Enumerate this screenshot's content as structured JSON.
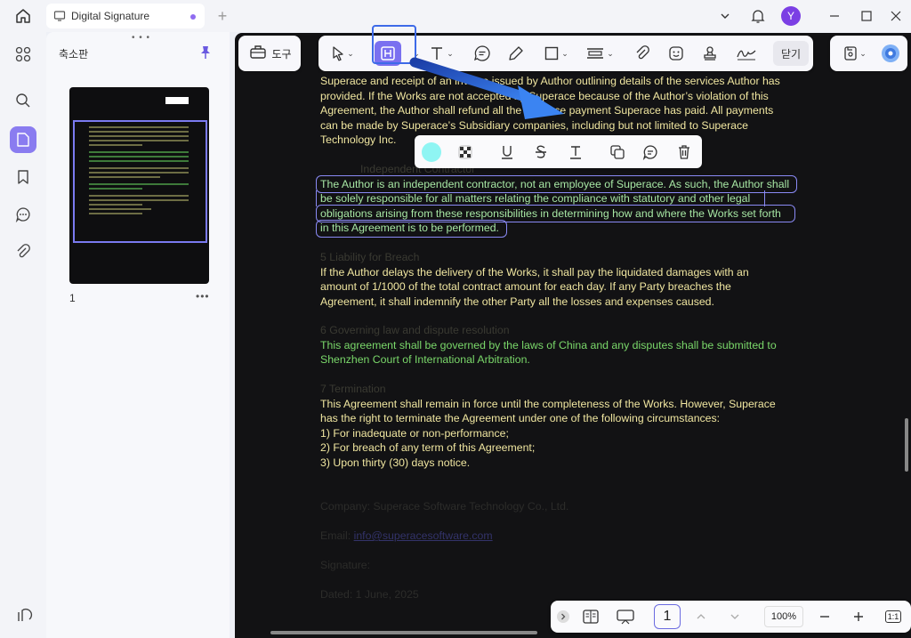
{
  "tab": {
    "title": "Digital Signature"
  },
  "user": {
    "initial": "Y"
  },
  "thumbnails": {
    "title": "축소판",
    "page_number": "1"
  },
  "toolbar": {
    "tools_label": "도구",
    "close_label": "닫기"
  },
  "document": {
    "para1": [
      "Superace and receipt of an invoice issued by Author outlining details of the services Author has",
      "provided. If the Works are not accepted by Superace because of the Author’s violation of this",
      "Agreement, the Author shall refund all the advance payment Superace has paid. All payments",
      "can be made by Superace’s Subsidiary companies, including but not limited to Superace",
      "Technology Inc."
    ],
    "heading_independent": "Independent Contractor",
    "para2": [
      "The Author is an independent contractor, not an employee of Superace. As such, the Author shall",
      "be solely responsible for all matters relating the compliance with statutory and other legal",
      "obligations arising from these responsibilities in determining how and where the Works set forth",
      "in this Agreement is to be performed."
    ],
    "heading5": "5         Liability for Breach",
    "para3": [
      "If the Author delays the delivery of the Works, it shall pay the liquidated damages with an",
      "amount of 1/1000 of the total contract amount for each day. If any Party breaches the",
      "Agreement, it shall indemnify the other Party all the losses and expenses caused."
    ],
    "heading6": "6         Governing law and dispute resolution",
    "para4": [
      "This agreement shall be governed by the laws of China and any disputes shall be submitted to",
      "Shenzhen Court of International Arbitration."
    ],
    "heading7": "7         Termination",
    "para5": [
      "This Agreement shall remain in force until the completeness of the Works. However, Superace",
      "has the right to terminate the Agreement under one of the following circumstances:",
      "1) For inadequate or non-performance;",
      "2) For breach of any term of this Agreement;",
      "3)  Upon thirty (30) days notice."
    ],
    "company": "Company: Superace Software Technology Co., Ltd.",
    "email_label": "Email: ",
    "email_value": "info@superacesoftware.com",
    "signature": "Signature:",
    "dated": "Dated: 1 June, 2025"
  },
  "highlight_popup": {
    "color": "#8ff5f3"
  },
  "bottom": {
    "page": "1",
    "zoom": "100%",
    "fit_label": "1:1"
  },
  "colors": {
    "accent": "#7a70f0",
    "annotation_arrow": "#2f6fe8"
  }
}
